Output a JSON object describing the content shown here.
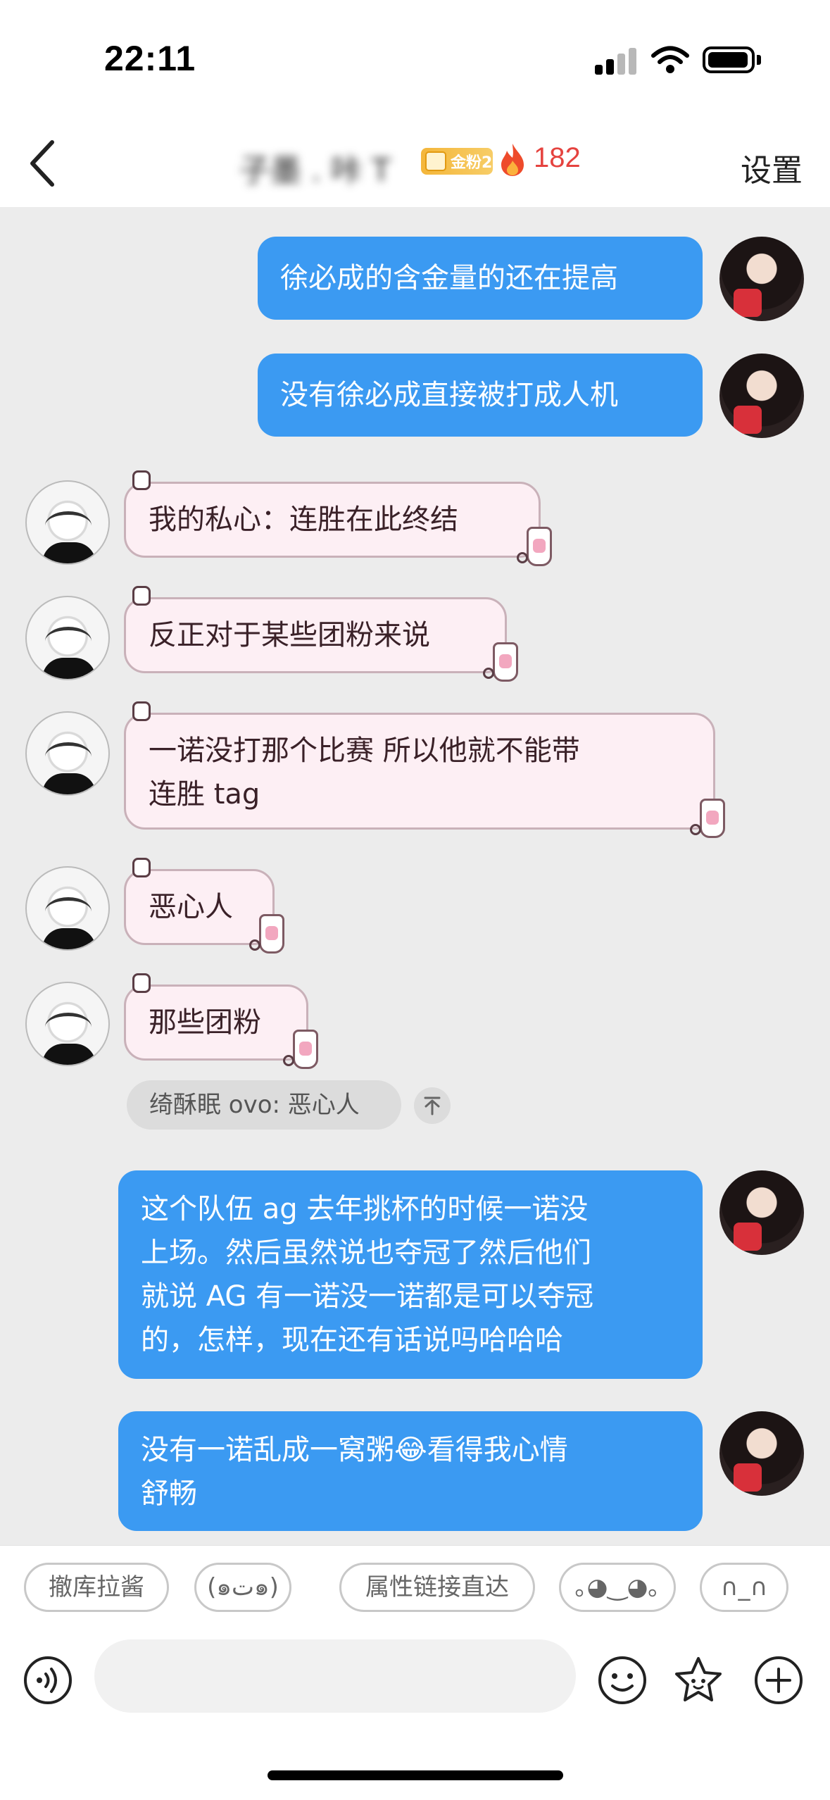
{
  "status_bar": {
    "time": "22:11"
  },
  "header": {
    "contact_name": "子墨 . 咔 T",
    "fan_badge": "金粉2",
    "fire_count": "182",
    "settings_label": "设置",
    "colors": {
      "fire": "#e5433f",
      "badge": "#f4b63a"
    }
  },
  "messages": [
    {
      "sender": "me",
      "text": "徐必成的含金量的还在提高"
    },
    {
      "sender": "me",
      "text": "没有徐必成直接被打成人机"
    },
    {
      "sender": "other",
      "text": "我的私心：连胜在此终结"
    },
    {
      "sender": "other",
      "text": "反正对于某些团粉来说"
    },
    {
      "sender": "other",
      "lines": [
        "一诺没打那个比赛 所以他就不能带",
        "连胜 tag"
      ]
    },
    {
      "sender": "other",
      "text": "恶心人"
    },
    {
      "sender": "other",
      "text": "那些团粉"
    },
    {
      "sender": "me",
      "lines": [
        "这个队伍 ag 去年挑杯的时候一诺没",
        "上场。然后虽然说也夺冠了然后他们",
        "就说 AG 有一诺没一诺都是可以夺冠",
        "的，怎样，现在还有话说吗哈哈哈"
      ]
    },
    {
      "sender": "me",
      "lines": [
        "没有一诺乱成一窝粥😂看得我心情",
        "舒畅"
      ]
    }
  ],
  "quote": {
    "text": "绮酥眠 ovo: 恶心人"
  },
  "quick_replies": [
    "撤库拉酱",
    "(๑ت๑)",
    "属性链接直达",
    "｡◕‿◕｡",
    "∩_∩"
  ],
  "input": {
    "placeholder": ""
  },
  "icons": {
    "back": "chevron-left-icon",
    "fire": "fire-icon",
    "voice": "voice-icon",
    "emoji": "emoji-icon",
    "sticker": "sticker-icon",
    "plus": "plus-icon"
  },
  "colors": {
    "my_bubble": "#3b9af2",
    "other_bubble": "#fdeff4",
    "chat_background": "#ececec"
  }
}
